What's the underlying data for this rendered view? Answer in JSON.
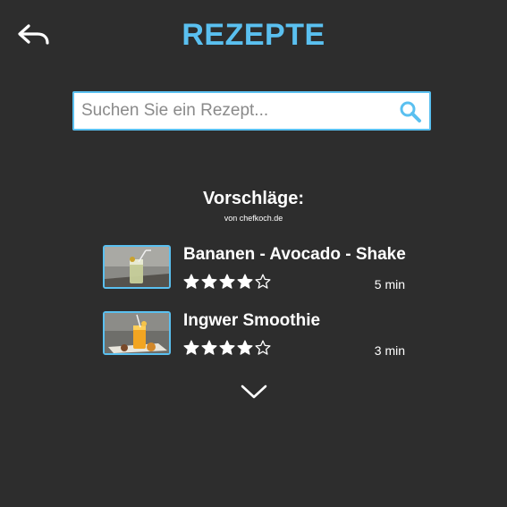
{
  "header": {
    "title": "REZEPTE",
    "back_icon": "back-arrow-icon"
  },
  "search": {
    "placeholder": "Suchen Sie ein Rezept...",
    "value": "",
    "icon": "search-icon"
  },
  "suggestions": {
    "heading": "Vorschläge:",
    "source": "von chefkoch.de",
    "more_icon": "chevron-down-icon",
    "items": [
      {
        "name": "Bananen - Avocado - Shake",
        "rating": 4,
        "max_rating": 5,
        "time": "5 min"
      },
      {
        "name": "Ingwer Smoothie",
        "rating": 4,
        "max_rating": 5,
        "time": "3 min"
      }
    ]
  },
  "colors": {
    "background": "#2d2d2d",
    "accent": "#5ac0f0",
    "text": "#ffffff"
  }
}
